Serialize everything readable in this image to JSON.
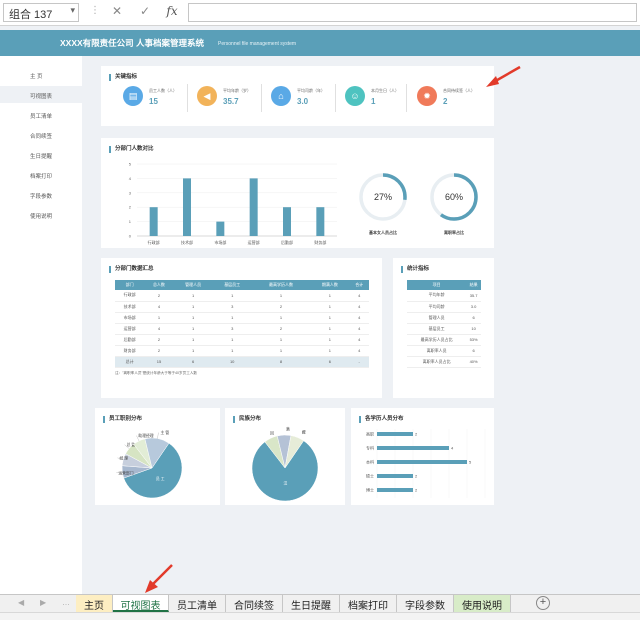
{
  "formula_bar": {
    "name_box": "组合 137",
    "cancel_icon": "✕",
    "confirm_icon": "✓",
    "fx_label": "fx",
    "formula": ""
  },
  "banner": {
    "title": "XXXX有限责任公司   人事档案管理系统",
    "subtitle": "Personnel file management system"
  },
  "nav": [
    {
      "label": "主    页",
      "active": false
    },
    {
      "label": "可视图表",
      "active": true
    },
    {
      "label": "员工清单",
      "active": false
    },
    {
      "label": "合同续签",
      "active": false
    },
    {
      "label": "生日提醒",
      "active": false
    },
    {
      "label": "档案打印",
      "active": false
    },
    {
      "label": "字段参数",
      "active": false
    },
    {
      "label": "使用说明",
      "active": false
    }
  ],
  "kpi": {
    "title": "关键指标",
    "items": [
      {
        "label": "员工人数（人）",
        "value": "15",
        "icon": "clipboard-icon",
        "color": "#5aa9e6"
      },
      {
        "label": "平均年龄（岁）",
        "value": "35.7",
        "icon": "megaphone-icon",
        "color": "#f2b35a"
      },
      {
        "label": "平均司龄（年）",
        "value": "3.0",
        "icon": "house-icon",
        "color": "#5aa9e6"
      },
      {
        "label": "本月生日（人）",
        "value": "1",
        "icon": "person-icon",
        "color": "#4ec3c0"
      },
      {
        "label": "合同待续签（人）",
        "value": "2",
        "icon": "alarm-icon",
        "color": "#f07a5a"
      }
    ]
  },
  "dept_chart": {
    "title": "分部门人数对比",
    "chart_data": {
      "type": "bar",
      "categories": [
        "行政部",
        "技术部",
        "市场部",
        "运营部",
        "后勤部",
        "财务部"
      ],
      "values": [
        2,
        4,
        1,
        4,
        2,
        2
      ],
      "ylim": [
        0,
        5
      ],
      "yticks": [
        "0",
        "1",
        "2",
        "3",
        "4",
        "5"
      ]
    },
    "donuts": [
      {
        "value_label": "27%",
        "fraction": 0.27,
        "caption": "基本女人员占比"
      },
      {
        "value_label": "60%",
        "fraction": 0.6,
        "caption": "离职率占比"
      }
    ]
  },
  "dept_table": {
    "title": "分部门数据汇总",
    "headers": [
      "部门",
      "总人数",
      "管理人员",
      "基层员工",
      "最高学历人数",
      "期满人数",
      "合计"
    ],
    "rows": [
      [
        "行政部",
        "2",
        "1",
        "1",
        "1",
        "1",
        "4"
      ],
      [
        "技术部",
        "4",
        "1",
        "3",
        "2",
        "1",
        "4"
      ],
      [
        "市场部",
        "1",
        "1",
        "1",
        "1",
        "1",
        "4"
      ],
      [
        "运营部",
        "4",
        "1",
        "3",
        "2",
        "1",
        "4"
      ],
      [
        "后勤部",
        "2",
        "1",
        "1",
        "1",
        "1",
        "4"
      ],
      [
        "财务部",
        "2",
        "1",
        "1",
        "1",
        "1",
        "4"
      ]
    ],
    "sum_row": [
      "总计",
      "15",
      "6",
      "10",
      "8",
      "6",
      "-"
    ],
    "note": "注：\"离职率人员\"是统计年龄大于等于40岁员工人数"
  },
  "stats": {
    "title": "统计指标",
    "headers": [
      "项目",
      "结果"
    ],
    "rows": [
      [
        "平均年龄",
        "35.7"
      ],
      [
        "平均司龄",
        "3.0"
      ],
      [
        "管理人员",
        "6"
      ],
      [
        "基层员工",
        "10"
      ],
      [
        "最高学历人员占比",
        "53%"
      ],
      [
        "离职率人员",
        "6"
      ],
      [
        "离职率人员占比",
        "40%"
      ]
    ]
  },
  "pie_job": {
    "title": "员工职别分布",
    "chart_data": {
      "type": "pie",
      "labels": [
        "员 工",
        "运营部门",
        "经 理",
        "总 监",
        "助理经理",
        "主 管"
      ],
      "values": [
        9,
        1,
        1,
        1,
        1,
        2
      ],
      "colors": [
        "#5a9fb8",
        "#a7b8cf",
        "#c7cfdd",
        "#d6e4c3",
        "#e2edd6",
        "#b7c9dc"
      ]
    }
  },
  "pie_ethnic": {
    "title": "民族分布",
    "chart_data": {
      "type": "pie",
      "labels": [
        "汉",
        "回",
        "满",
        "藏"
      ],
      "values": [
        12,
        1,
        1,
        1
      ],
      "colors": [
        "#5a9fb8",
        "#d9e6c8",
        "#b5c2d6",
        "#e6ecd8"
      ]
    }
  },
  "edu_chart": {
    "title": "各学历人员分布",
    "chart_data": {
      "type": "bar",
      "orientation": "horizontal",
      "categories": [
        "高职",
        "专科",
        "本科",
        "硕士",
        "博士"
      ],
      "values": [
        2,
        4,
        5,
        2,
        2
      ],
      "value_labels": [
        "2",
        "4",
        "5",
        "2",
        "2"
      ],
      "xlim": [
        0,
        6
      ]
    }
  },
  "tabs": [
    {
      "label": "主页",
      "bg": "#fdeec2",
      "active": false
    },
    {
      "label": "可视图表",
      "bg": "#ffffff",
      "active": true
    },
    {
      "label": "员工清单",
      "bg": "#f0f0f0",
      "active": false
    },
    {
      "label": "合同续签",
      "bg": "#f0f0f0",
      "active": false
    },
    {
      "label": "生日提醒",
      "bg": "#f0f0f0",
      "active": false
    },
    {
      "label": "档案打印",
      "bg": "#f0f0f0",
      "active": false
    },
    {
      "label": "字段参数",
      "bg": "#f0f0f0",
      "active": false
    },
    {
      "label": "使用说明",
      "bg": "#d8ecc8",
      "active": false
    }
  ],
  "add_sheet_icon": "+"
}
